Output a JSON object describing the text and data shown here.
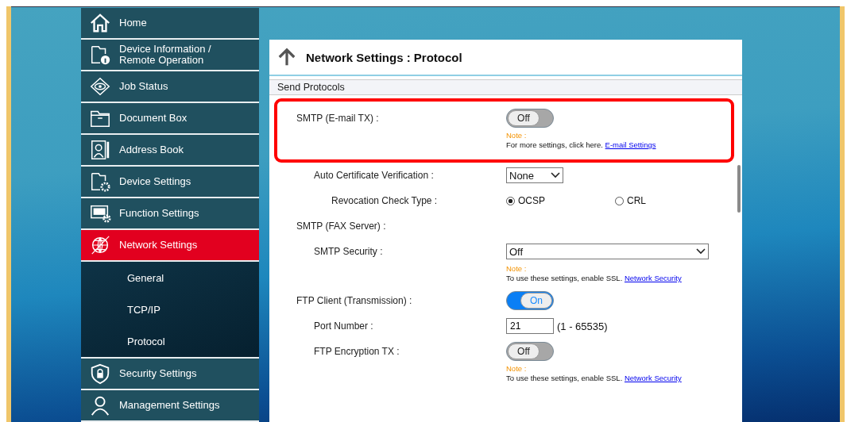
{
  "sidebar": {
    "items": [
      {
        "label": "Home",
        "selected": false
      },
      {
        "label": "Device Information / Remote Operation",
        "selected": false
      },
      {
        "label": "Job Status",
        "selected": false
      },
      {
        "label": "Document Box",
        "selected": false
      },
      {
        "label": "Address Book",
        "selected": false
      },
      {
        "label": "Device Settings",
        "selected": false
      },
      {
        "label": "Function Settings",
        "selected": false
      },
      {
        "label": "Network Settings",
        "selected": true,
        "expanded": true,
        "children": [
          {
            "label": "General"
          },
          {
            "label": "TCP/IP"
          },
          {
            "label": "Protocol"
          }
        ]
      },
      {
        "label": "Security Settings",
        "selected": false
      },
      {
        "label": "Management Settings",
        "selected": false
      }
    ]
  },
  "page": {
    "title": "Network Settings : Protocol",
    "section": "Send Protocols",
    "rows": [
      {
        "kind": "toggle",
        "label": "SMTP (E-mail TX) :",
        "on": false,
        "value": "Off",
        "highlighted": true,
        "note": {
          "label": "Note :",
          "text": "For more settings, click here.",
          "link": "E-mail Settings"
        },
        "children": [
          {
            "kind": "select",
            "label": "Auto Certificate Verification :",
            "value": "None",
            "highlighted": false,
            "children": [
              {
                "kind": "radio",
                "label": "Revocation Check Type :",
                "highlighted": false,
                "options": [
                  {
                    "label": "OCSP",
                    "selected": true
                  },
                  {
                    "label": "CRL",
                    "selected": false
                  }
                ]
              }
            ]
          }
        ]
      },
      {
        "kind": "heading",
        "label": "SMTP (FAX Server) :",
        "highlighted": false,
        "children": [
          {
            "kind": "select-wide",
            "label": "SMTP Security :",
            "value": "Off",
            "highlighted": false,
            "note": {
              "label": "Note :",
              "text": "To use these settings, enable SSL.",
              "link": "Network Security"
            }
          }
        ]
      },
      {
        "kind": "toggle",
        "label": "FTP Client (Transmission) :",
        "on": true,
        "value": "On",
        "highlighted": false,
        "children": [
          {
            "kind": "number",
            "label": "Port Number :",
            "value": "21",
            "range": "(1 - 65535)",
            "highlighted": false
          },
          {
            "kind": "toggle",
            "label": "FTP Encryption TX :",
            "on": false,
            "value": "Off",
            "highlighted": false,
            "note": {
              "label": "Note :",
              "text": "To use these settings, enable SSL.",
              "link": "Network Security"
            }
          }
        ]
      }
    ]
  }
}
